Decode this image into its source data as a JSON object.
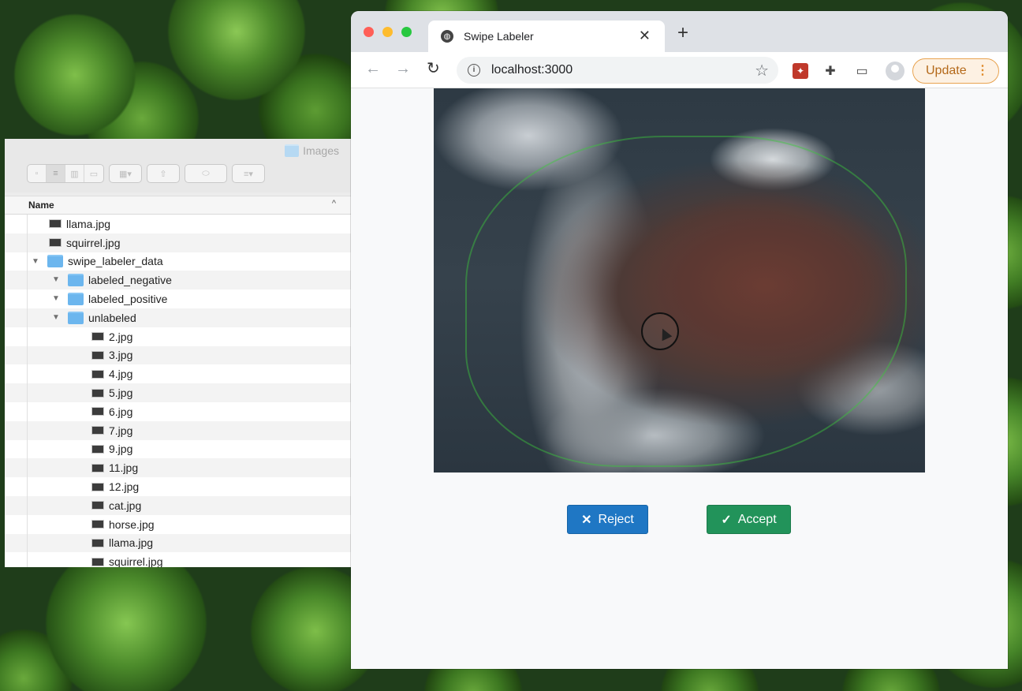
{
  "finder": {
    "title": "Images",
    "column_header": "Name",
    "rows": [
      {
        "label": "llama.jpg",
        "kind": "file",
        "indent": 1
      },
      {
        "label": "squirrel.jpg",
        "kind": "file",
        "indent": 1
      },
      {
        "label": "swipe_labeler_data",
        "kind": "folder",
        "indent": 1,
        "expanded": true
      },
      {
        "label": "labeled_negative",
        "kind": "folder",
        "indent": 2,
        "expanded": true
      },
      {
        "label": "labeled_positive",
        "kind": "folder",
        "indent": 2,
        "expanded": true
      },
      {
        "label": "unlabeled",
        "kind": "folder",
        "indent": 2,
        "expanded": true
      },
      {
        "label": "2.jpg",
        "kind": "file",
        "indent": 3
      },
      {
        "label": "3.jpg",
        "kind": "file",
        "indent": 3
      },
      {
        "label": "4.jpg",
        "kind": "file",
        "indent": 3
      },
      {
        "label": "5.jpg",
        "kind": "file",
        "indent": 3
      },
      {
        "label": "6.jpg",
        "kind": "file",
        "indent": 3
      },
      {
        "label": "7.jpg",
        "kind": "file",
        "indent": 3
      },
      {
        "label": "9.jpg",
        "kind": "file",
        "indent": 3
      },
      {
        "label": "11.jpg",
        "kind": "file",
        "indent": 3
      },
      {
        "label": "12.jpg",
        "kind": "file",
        "indent": 3
      },
      {
        "label": "cat.jpg",
        "kind": "file",
        "indent": 3
      },
      {
        "label": "horse.jpg",
        "kind": "file",
        "indent": 3
      },
      {
        "label": "llama.jpg",
        "kind": "file",
        "indent": 3
      },
      {
        "label": "squirrel.jpg",
        "kind": "file",
        "indent": 3
      }
    ]
  },
  "browser": {
    "tab_title": "Swipe Labeler",
    "url": "localhost:3000",
    "update_label": "Update"
  },
  "app": {
    "reject_label": "Reject",
    "accept_label": "Accept",
    "reject_color": "#1f77c4",
    "accept_color": "#22935a"
  }
}
